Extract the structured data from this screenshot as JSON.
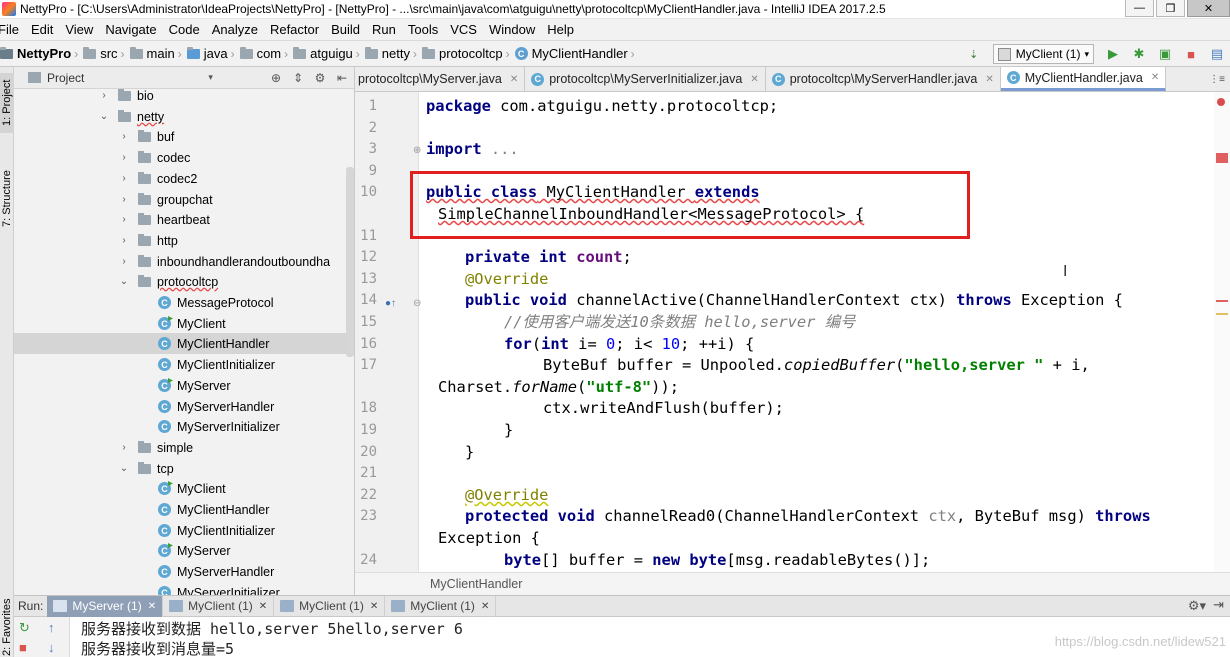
{
  "window": {
    "title": "NettyPro - [C:\\Users\\Administrator\\IdeaProjects\\NettyPro] - [NettyPro] - ...\\src\\main\\java\\com\\atguigu\\netty\\protocoltcp\\MyClientHandler.java - IntelliJ IDEA 2017.2.5",
    "minimize": "—",
    "restore": "❐",
    "close": "✕"
  },
  "menu": [
    "File",
    "Edit",
    "View",
    "Navigate",
    "Code",
    "Analyze",
    "Refactor",
    "Build",
    "Run",
    "Tools",
    "VCS",
    "Window",
    "Help"
  ],
  "navbar": {
    "crumbs": [
      "NettyPro",
      "src",
      "main",
      "java",
      "com",
      "atguigu",
      "netty",
      "protocoltcp",
      "MyClientHandler"
    ],
    "run_config": "MyClient (1)"
  },
  "left_strip": {
    "project_tab": "1: Project",
    "structure_tab": "7: Structure",
    "favorites_tab": "2: Favorites"
  },
  "project_panel": {
    "header": "Project",
    "tree": [
      {
        "label": "bio",
        "type": "folder",
        "expanded": false,
        "depth": 0
      },
      {
        "label": "netty",
        "type": "folder",
        "expanded": true,
        "depth": 0
      },
      {
        "label": "buf",
        "type": "folder",
        "expanded": false,
        "depth": 1
      },
      {
        "label": "codec",
        "type": "folder",
        "expanded": false,
        "depth": 1
      },
      {
        "label": "codec2",
        "type": "folder",
        "expanded": false,
        "depth": 1
      },
      {
        "label": "groupchat",
        "type": "folder",
        "expanded": false,
        "depth": 1
      },
      {
        "label": "heartbeat",
        "type": "folder",
        "expanded": false,
        "depth": 1
      },
      {
        "label": "http",
        "type": "folder",
        "expanded": false,
        "depth": 1
      },
      {
        "label": "inboundhandlerandoutboundha",
        "type": "folder",
        "expanded": false,
        "depth": 1
      },
      {
        "label": "protocoltcp",
        "type": "folder",
        "expanded": true,
        "depth": 1
      },
      {
        "label": "MessageProtocol",
        "type": "class",
        "depth": 2
      },
      {
        "label": "MyClient",
        "type": "class-run",
        "depth": 2
      },
      {
        "label": "MyClientHandler",
        "type": "class",
        "depth": 2,
        "selected": true
      },
      {
        "label": "MyClientInitializer",
        "type": "class",
        "depth": 2
      },
      {
        "label": "MyServer",
        "type": "class-run",
        "depth": 2
      },
      {
        "label": "MyServerHandler",
        "type": "class",
        "depth": 2
      },
      {
        "label": "MyServerInitializer",
        "type": "class",
        "depth": 2
      },
      {
        "label": "simple",
        "type": "folder",
        "expanded": false,
        "depth": 1
      },
      {
        "label": "tcp",
        "type": "folder",
        "expanded": true,
        "depth": 1
      },
      {
        "label": "MyClient",
        "type": "class-run",
        "depth": 2
      },
      {
        "label": "MyClientHandler",
        "type": "class",
        "depth": 2
      },
      {
        "label": "MyClientInitializer",
        "type": "class",
        "depth": 2
      },
      {
        "label": "MyServer",
        "type": "class-run",
        "depth": 2
      },
      {
        "label": "MyServerHandler",
        "type": "class",
        "depth": 2
      },
      {
        "label": "MyServerInitializer",
        "type": "class",
        "depth": 2
      }
    ]
  },
  "editor_tabs": [
    {
      "label": "protocoltcp\\MyServer.java"
    },
    {
      "label": "protocoltcp\\MyServerInitializer.java"
    },
    {
      "label": "protocoltcp\\MyServerHandler.java"
    },
    {
      "label": "MyClientHandler.java",
      "active": true
    }
  ],
  "line_numbers": [
    "1",
    "2",
    "3",
    "9",
    "10",
    "",
    "11",
    "12",
    "13",
    "14",
    "15",
    "16",
    "17",
    "",
    "18",
    "19",
    "20",
    "21",
    "22",
    "23",
    "",
    "24"
  ],
  "code": {
    "l1_kw": "package",
    "l1_rest": " com.atguigu.netty.protocoltcp;",
    "l3_kw": "import",
    "l3_rest": " ...",
    "l10_kw1": "public class",
    "l10_name": " MyClientHandler ",
    "l10_kw2": "extends",
    "l10b": "SimpleChannelInboundHandler<MessageProtocol> {",
    "l12_kw": "private int",
    "l12_fld": " count",
    "l12_end": ";",
    "l13_ann": "@Override",
    "l14_kw": "public void",
    "l14_sig": " channelActive(ChannelHandlerContext ctx) ",
    "l14_kw2": "throws",
    "l14_end": " Exception {",
    "l15_cmt": "//使用客户端发送10条数据 hello,server 编号",
    "l16_kw": "for",
    "l16_a": "(",
    "l16_kw2": "int",
    "l16_b": " i= ",
    "l16_n1": "0",
    "l16_c": "; i< ",
    "l16_n2": "10",
    "l16_d": "; ++i) {",
    "l17_a": "ByteBuf buffer = Unpooled.",
    "l17_it": "copiedBuffer",
    "l17_b": "(",
    "l17_str": "\"hello,server \"",
    "l17_c": " + i,",
    "l17b_a": "Charset.",
    "l17b_it": "forName",
    "l17b_b": "(",
    "l17b_str": "\"utf-8\"",
    "l17b_c": "));",
    "l18": "ctx.writeAndFlush(buffer);",
    "l19": "}",
    "l20": "}",
    "l22_ann": "@Override",
    "l23_kw": "protected void",
    "l23_sig": " channelRead0(ChannelHandlerContext ",
    "l23_ctx": "ctx",
    "l23_sig2": ", ByteBuf msg) ",
    "l23_kw2": "throws",
    "l23b": "Exception {",
    "l24_kw": "byte",
    "l24_a": "[] buffer = ",
    "l24_kw2": "new byte",
    "l24_b": "[msg.readableBytes()];"
  },
  "editor_breadcrumb": "MyClientHandler",
  "run_panel": {
    "label": "Run:",
    "tabs": [
      {
        "label": "MyServer (1)",
        "active": true
      },
      {
        "label": "MyClient (1)"
      },
      {
        "label": "MyClient (1)"
      },
      {
        "label": "MyClient (1)"
      }
    ],
    "console": [
      "服务器接收到数据 hello,server 5hello,server 6",
      "服务器接收到消息量=5"
    ],
    "watermark": "https://blog.csdn.net/lidew521"
  }
}
